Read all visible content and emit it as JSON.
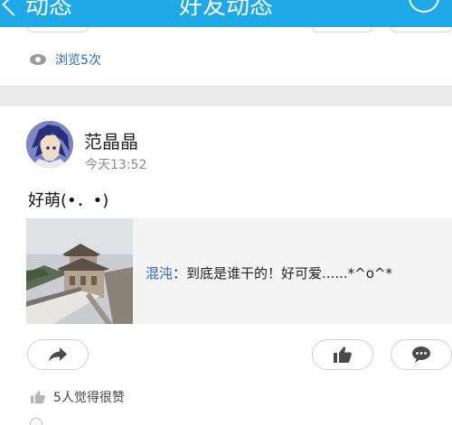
{
  "header": {
    "back_label": "动态",
    "title": "好友动态"
  },
  "previous_post": {
    "views_text": "浏览5次"
  },
  "post": {
    "author": "范晶晶",
    "time": "今天13:52",
    "content": "好萌(•．•)",
    "shared": {
      "commenter": "混沌",
      "separator": "：",
      "comment": "到底是谁干的！好可爱......*^o^*"
    },
    "likes_text": "5人觉得很赞"
  },
  "colors": {
    "header_bg": "#1fa8e6",
    "link": "#2b68a8",
    "separator": "#ececec"
  },
  "icons": {
    "back": "chevron-left-icon",
    "add": "plus-circle-icon",
    "views": "eye-icon",
    "share": "share-arrow-icon",
    "like": "thumbs-up-icon",
    "comment": "speech-bubble-icon"
  }
}
